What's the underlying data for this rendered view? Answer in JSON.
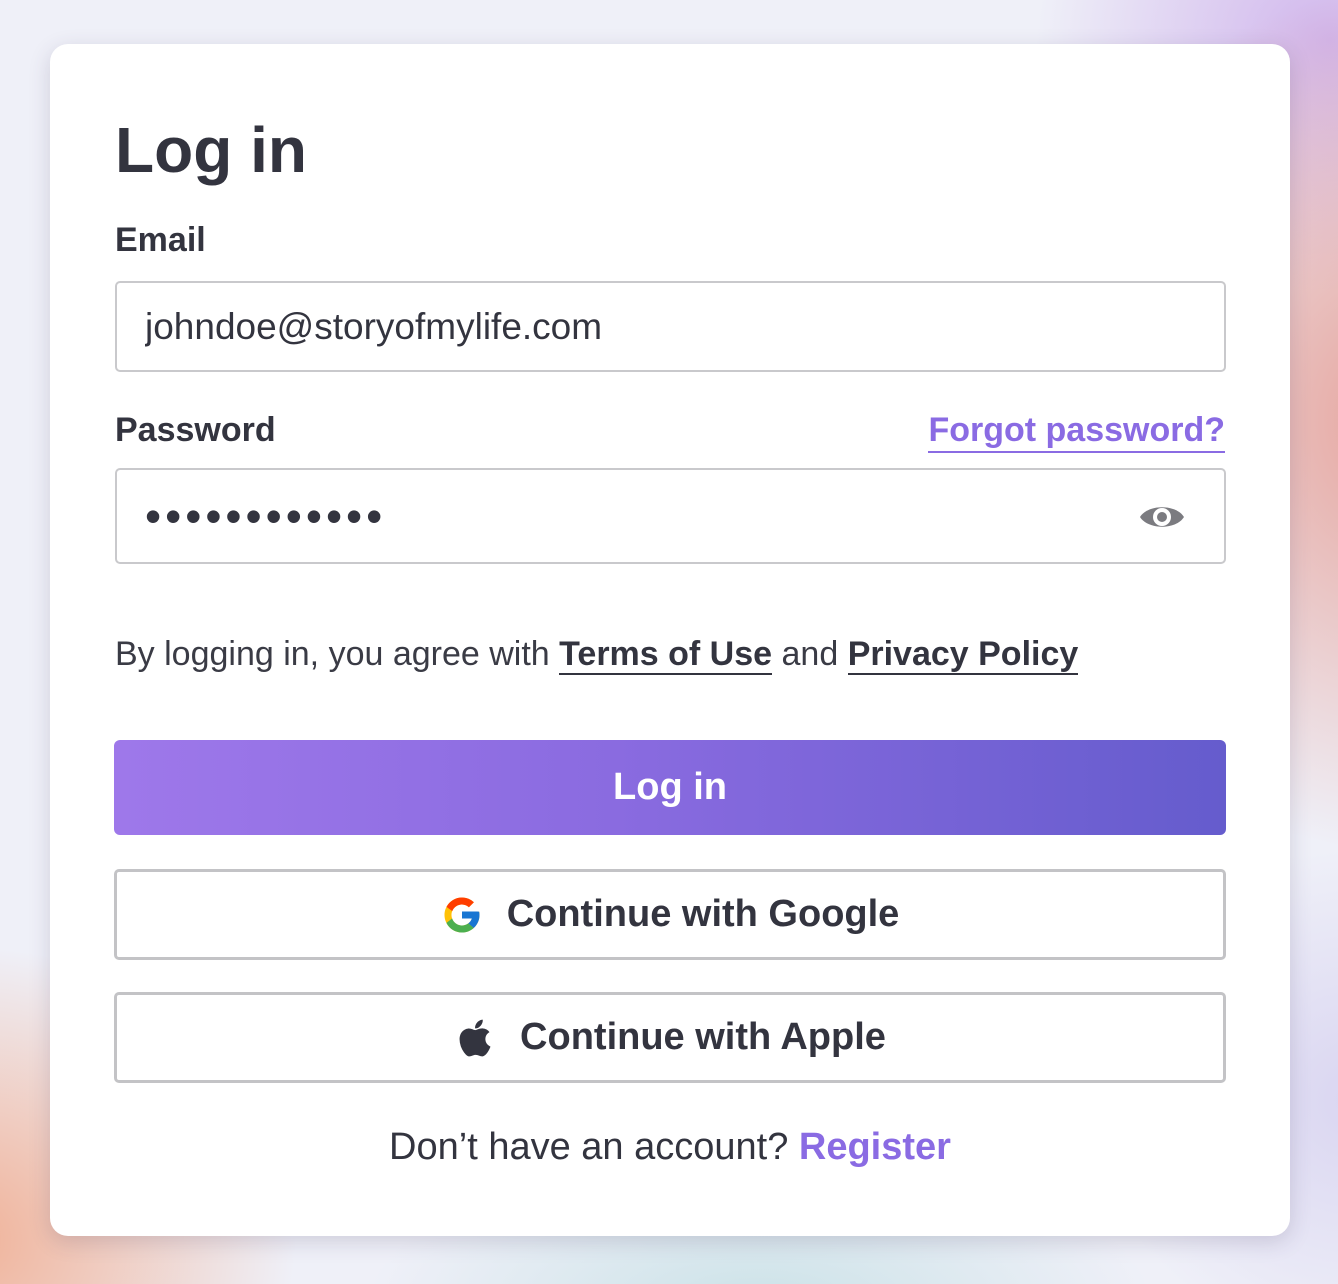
{
  "form": {
    "title": "Log in",
    "email_label": "Email",
    "email_value": "johndoe@storyofmylife.com",
    "password_label": "Password",
    "forgot_link": "Forgot password?",
    "password_value": "••••••••••••",
    "terms_prefix": "By logging in, you agree with ",
    "terms_link": "Terms of Use",
    "terms_and": " and ",
    "privacy_link": "Privacy Policy",
    "login_button": "Log in",
    "google_button": "Continue with Google",
    "apple_button": "Continue with Apple",
    "register_prompt": "Don’t have an account? ",
    "register_link": "Register"
  },
  "icons": {
    "password_toggle": "eye-icon",
    "google": "google-icon",
    "apple": "apple-icon"
  },
  "colors": {
    "accent": "#8a6be3",
    "button_gradient_start": "#9e78ea",
    "button_gradient_end": "#655ccd",
    "text": "#33343f"
  }
}
